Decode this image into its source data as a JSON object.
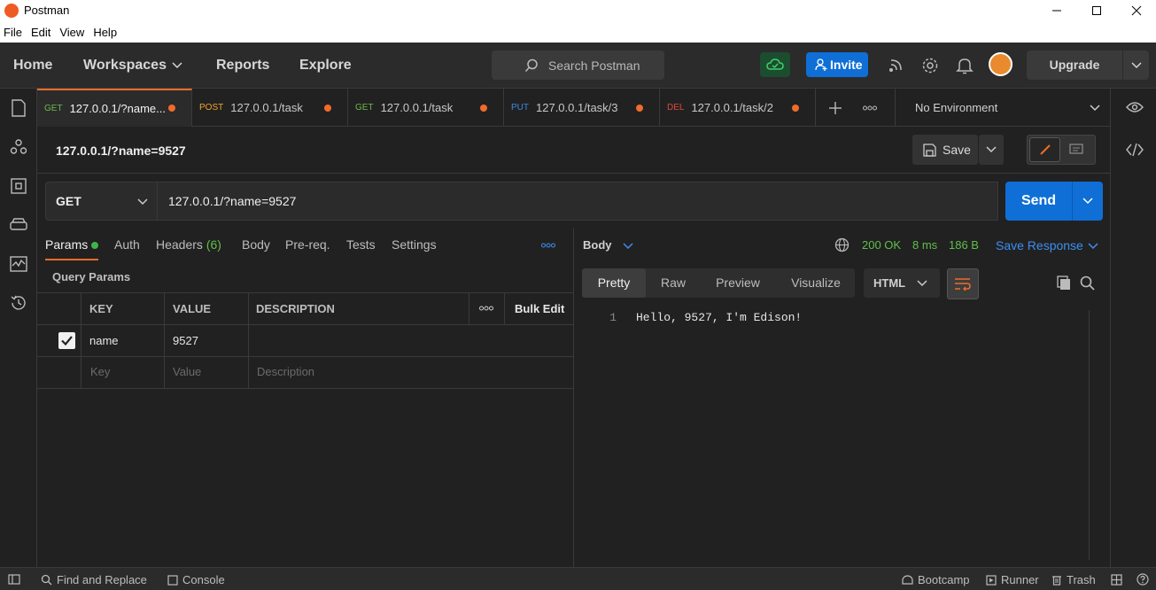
{
  "window": {
    "title": "Postman",
    "controls": [
      "minimize-icon",
      "maximize-icon",
      "close-icon"
    ]
  },
  "menu": {
    "items": [
      "File",
      "Edit",
      "View",
      "Help"
    ]
  },
  "header": {
    "nav": {
      "home": "Home",
      "workspaces": "Workspaces",
      "reports": "Reports",
      "explore": "Explore"
    },
    "search_placeholder": "Search Postman",
    "invite": "Invite",
    "upgrade": "Upgrade",
    "icons": [
      "cloud-sync-icon",
      "satellite-icon",
      "gear-icon",
      "bell-icon",
      "avatar"
    ]
  },
  "sidebar": {
    "icons": [
      "collections-icon",
      "apis-icon",
      "environments-icon",
      "mock-servers-icon",
      "monitors-icon",
      "history-icon"
    ]
  },
  "tabs": [
    {
      "method": "GET",
      "label": "127.0.0.1/?name...",
      "active": true,
      "unsaved": true
    },
    {
      "method": "POST",
      "label": "127.0.0.1/task",
      "active": false,
      "unsaved": true
    },
    {
      "method": "GET",
      "label": "127.0.0.1/task",
      "active": false,
      "unsaved": true
    },
    {
      "method": "PUT",
      "label": "127.0.0.1/task/3",
      "active": false,
      "unsaved": true
    },
    {
      "method": "DEL",
      "label": "127.0.0.1/task/2",
      "active": false,
      "unsaved": true
    }
  ],
  "environment": {
    "selected": "No Environment"
  },
  "request": {
    "title": "127.0.0.1/?name=9527",
    "save": "Save",
    "method": "GET",
    "url": "127.0.0.1/?name=9527",
    "send": "Send",
    "tabs": {
      "params": "Params",
      "auth": "Auth",
      "headers": "Headers",
      "headers_count": "(6)",
      "body": "Body",
      "prereq": "Pre-req.",
      "tests": "Tests",
      "settings": "Settings"
    },
    "query_params_title": "Query Params",
    "table": {
      "headers": {
        "key": "KEY",
        "value": "VALUE",
        "description": "DESCRIPTION",
        "bulk_edit": "Bulk Edit"
      },
      "rows": [
        {
          "checked": true,
          "key": "name",
          "value": "9527",
          "description": ""
        }
      ],
      "placeholders": {
        "key": "Key",
        "value": "Value",
        "description": "Description"
      }
    }
  },
  "response": {
    "body_label": "Body",
    "status": "200 OK",
    "time": "8 ms",
    "size": "186 B",
    "save_response": "Save Response",
    "views": {
      "pretty": "Pretty",
      "raw": "Raw",
      "preview": "Preview",
      "visualize": "Visualize"
    },
    "active_view": "Pretty",
    "language": "HTML",
    "lines": [
      {
        "num": "1",
        "text": "Hello, 9527, I'm Edison!"
      }
    ]
  },
  "statusbar": {
    "find_replace": "Find and Replace",
    "console": "Console",
    "bootcamp": "Bootcamp",
    "runner": "Runner",
    "trash": "Trash"
  },
  "colors": {
    "accent_orange": "#ef6c2b",
    "send_blue": "#0f6fd6",
    "success_green": "#5fbf4a",
    "background": "#212121"
  }
}
